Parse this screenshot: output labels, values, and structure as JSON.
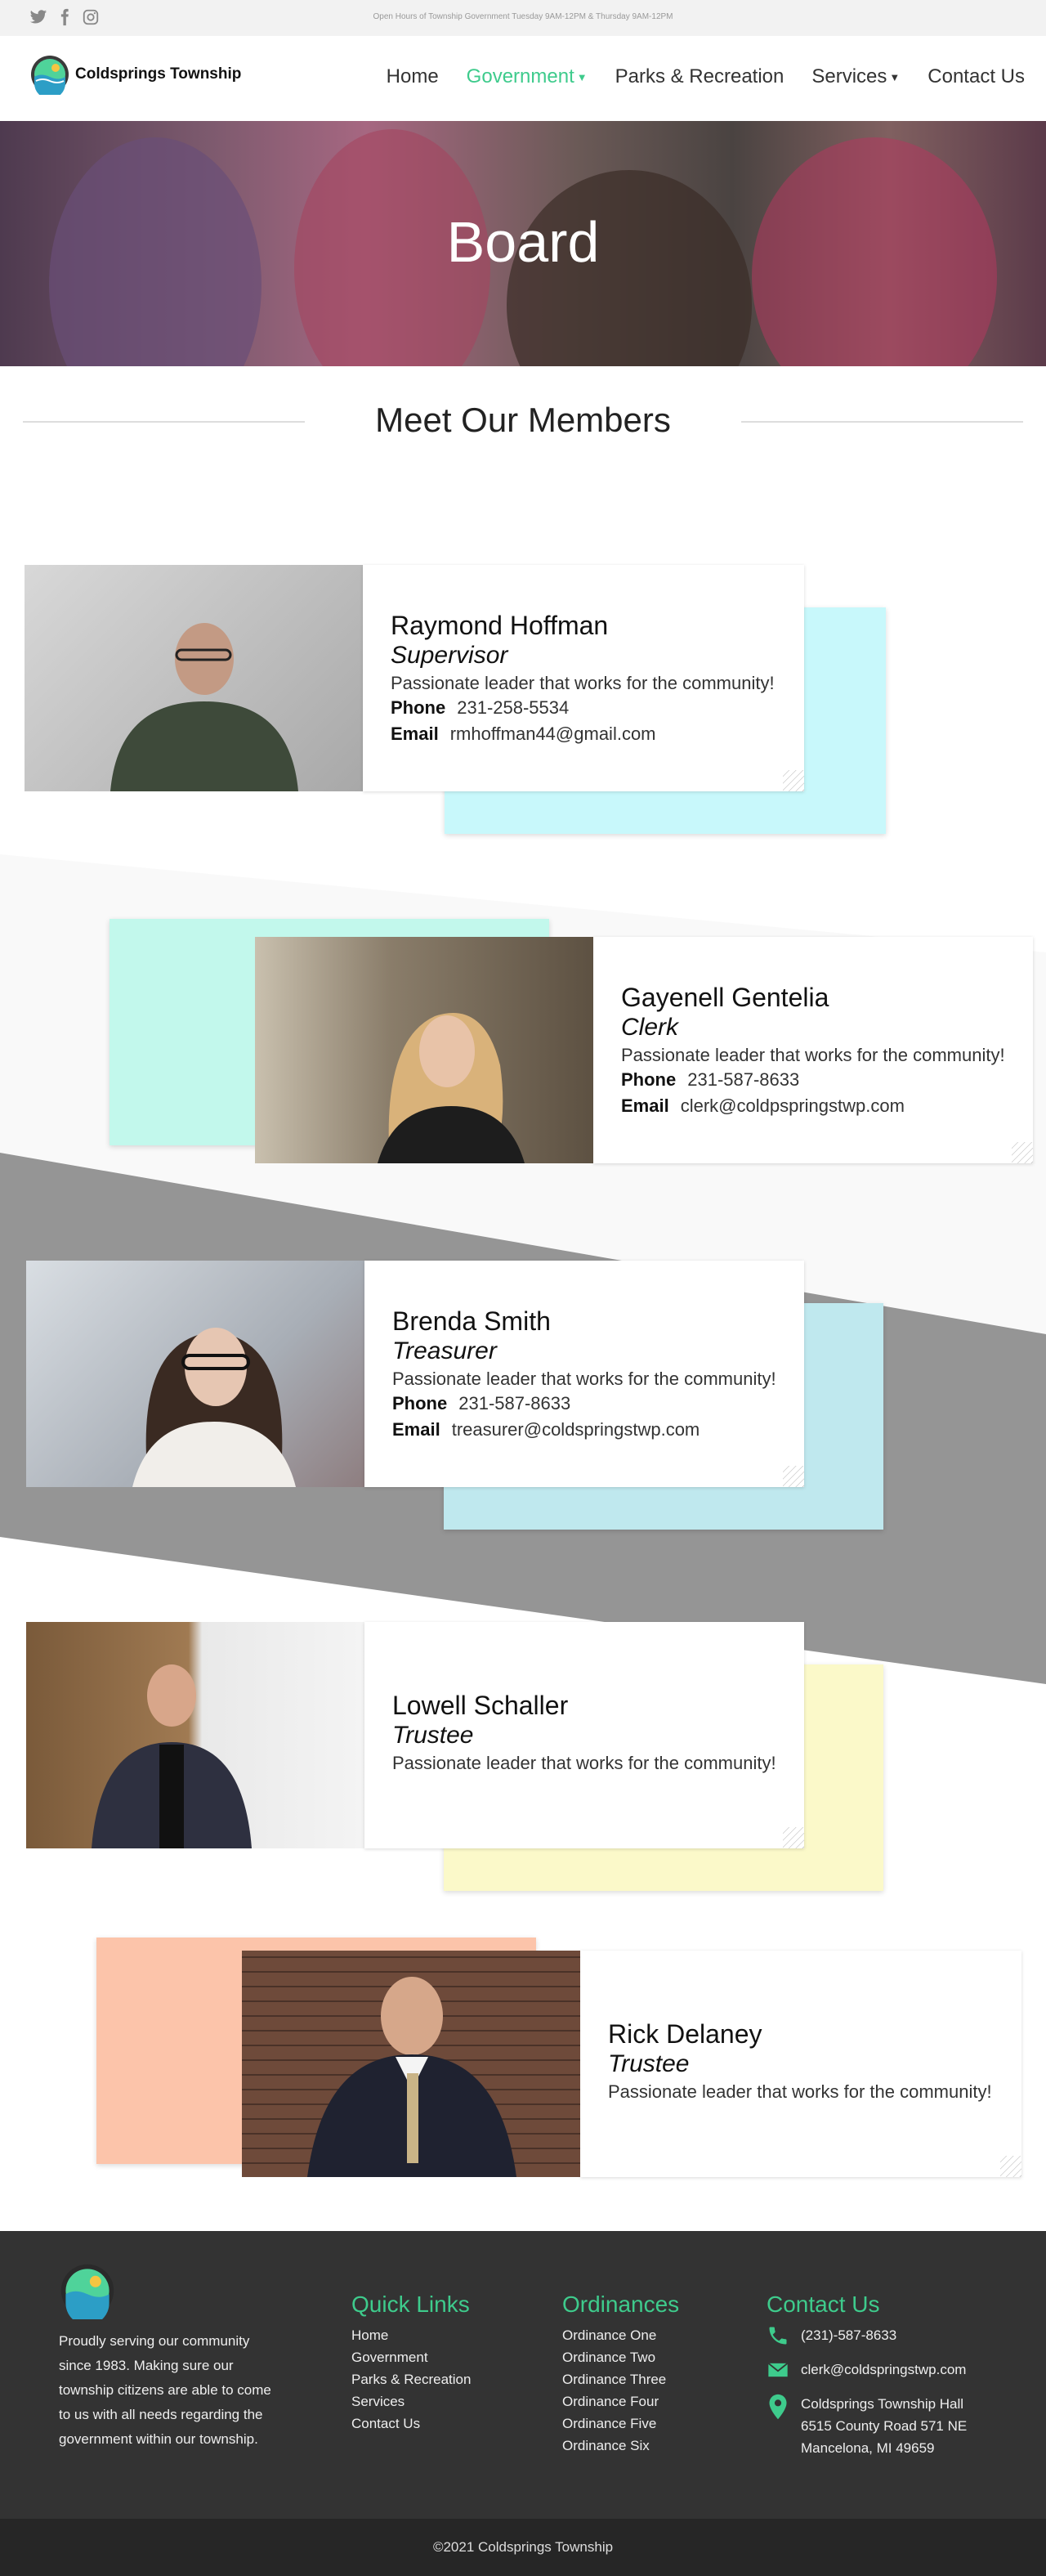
{
  "topbar": {
    "hours": "Open Hours of Township Government Tuesday 9AM-12PM & Thursday 9AM-12PM",
    "social": [
      "twitter-icon",
      "facebook-icon",
      "instagram-icon"
    ]
  },
  "brand": {
    "name": "Coldsprings Township",
    "accent": "#3ecb8c"
  },
  "nav": [
    {
      "label": "Home"
    },
    {
      "label": "Government",
      "active": true,
      "dropdown": true
    },
    {
      "label": "Parks & Recreation"
    },
    {
      "label": "Services",
      "dropdown": true
    },
    {
      "label": "Contact Us"
    }
  ],
  "hero": {
    "title": "Board"
  },
  "section": {
    "title": "Meet Our Members"
  },
  "members": [
    {
      "name": "Raymond Hoffman",
      "role": "Supervisor",
      "desc": "Passionate leader that works for the community!",
      "phone_label": "Phone",
      "phone": "231-258-5534",
      "email_label": "Email",
      "email": "rmhoffman44@gmail.com",
      "accent": "#c8f8fb"
    },
    {
      "name": "Gayenell Gentelia",
      "role": "Clerk",
      "desc": "Passionate leader that works for the community!",
      "phone_label": "Phone",
      "phone": "231-587-8633",
      "email_label": "Email",
      "email": "clerk@coldpspringstwp.com",
      "accent": "#c2f8ec"
    },
    {
      "name": "Brenda Smith",
      "role": "Treasurer",
      "desc": "Passionate leader that works for the community!",
      "phone_label": "Phone",
      "phone": "231-587-8633",
      "email_label": "Email",
      "email": "treasurer@coldspringstwp.com",
      "accent": "#bfe8ee"
    },
    {
      "name": "Lowell Schaller",
      "role": "Trustee",
      "desc": "Passionate leader that works for the community!",
      "accent": "#fbf9c9"
    },
    {
      "name": "Rick Delaney",
      "role": "Trustee",
      "desc": "Passionate leader that works for the community!",
      "accent": "#fcc4aa"
    }
  ],
  "footer": {
    "about": "Proudly serving our community since 1983. Making sure our township citizens are able to come to us with all needs regarding the government within our township.",
    "quick_links": {
      "title": "Quick Links",
      "items": [
        "Home",
        "Government",
        "Parks & Recreation",
        "Services",
        "Contact Us"
      ]
    },
    "ordinances": {
      "title": "Ordinances",
      "items": [
        "Ordinance One",
        "Ordinance Two",
        "Ordinance Three",
        "Ordinance Four",
        "Ordinance Five",
        "Ordinance Six"
      ]
    },
    "contact": {
      "title": "Contact Us",
      "phone": "(231)-587-8633",
      "email": "clerk@coldspringstwp.com",
      "address_lines": [
        "Coldsprings Township Hall",
        "6515 County Road 571 NE",
        "Mancelona, MI 49659"
      ]
    },
    "copyright": "©2021 Coldsprings Township"
  }
}
